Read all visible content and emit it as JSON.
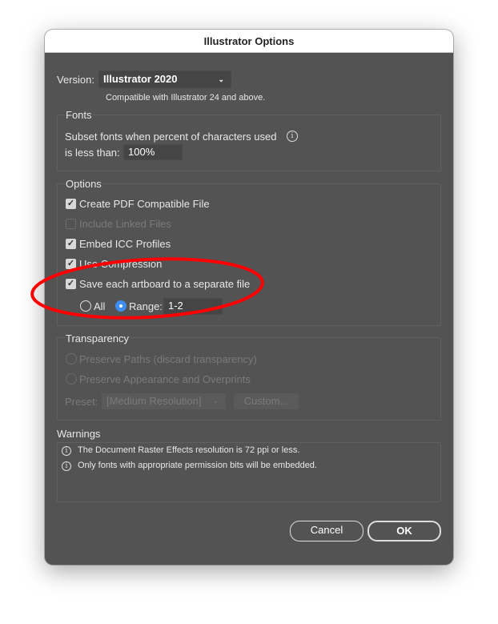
{
  "dialog": {
    "title": "Illustrator Options"
  },
  "version": {
    "label": "Version:",
    "value": "Illustrator 2020",
    "note": "Compatible with Illustrator 24 and above."
  },
  "fonts": {
    "title": "Fonts",
    "subset_label": "Subset fonts when percent of characters used",
    "less_than_label": "is less than:",
    "percent": "100%"
  },
  "options": {
    "title": "Options",
    "items": [
      {
        "label": "Create PDF Compatible File",
        "checked": true,
        "enabled": true
      },
      {
        "label": "Include Linked Files",
        "checked": false,
        "enabled": false
      },
      {
        "label": "Embed ICC Profiles",
        "checked": true,
        "enabled": true
      },
      {
        "label": "Use Compression",
        "checked": true,
        "enabled": true
      },
      {
        "label": "Save each artboard to a separate file",
        "checked": true,
        "enabled": true
      }
    ],
    "all_label": "All",
    "range_label": "Range:",
    "range_value": "1-2",
    "selected": "Range"
  },
  "transparency": {
    "title": "Transparency",
    "paths_label": "Preserve Paths (discard transparency)",
    "appearance_label": "Preserve Appearance and Overprints",
    "preset_label": "Preset:",
    "preset_value": "[Medium Resolution]",
    "custom_label": "Custom..."
  },
  "warnings": {
    "title": "Warnings",
    "items": [
      "The Document Raster Effects resolution is 72 ppi or less.",
      "Only fonts with appropriate permission bits will be embedded."
    ]
  },
  "buttons": {
    "cancel": "Cancel",
    "ok": "OK"
  },
  "annotation": {
    "color": "#ff0000"
  }
}
